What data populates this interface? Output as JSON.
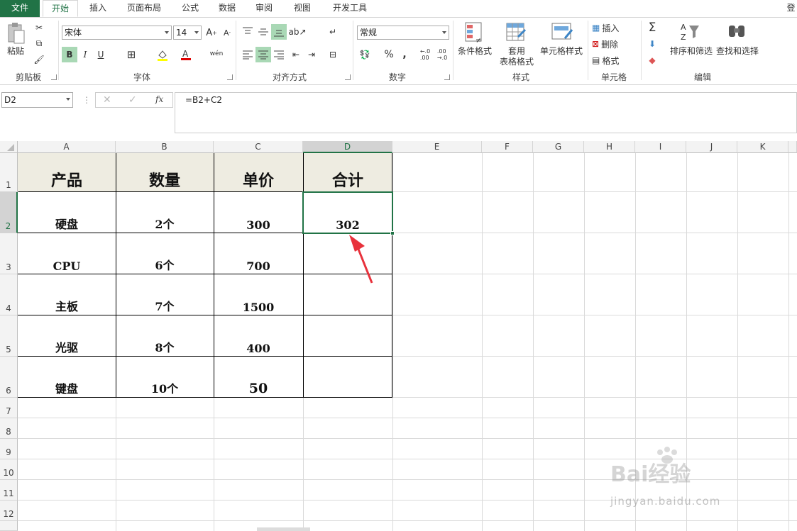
{
  "tabs": [
    "文件",
    "开始",
    "插入",
    "页面布局",
    "公式",
    "数据",
    "审阅",
    "视图",
    "开发工具"
  ],
  "login_label": "登",
  "ribbon": {
    "clipboard": {
      "paste_label": "粘贴",
      "group_label": "剪贴板"
    },
    "font": {
      "name": "宋体",
      "size": "14",
      "bold": "B",
      "italic": "I",
      "underline": "U",
      "wen": "wén",
      "group_label": "字体"
    },
    "alignment": {
      "group_label": "对齐方式"
    },
    "number": {
      "format": "常规",
      "percent": "%",
      "comma": ",",
      "group_label": "数字"
    },
    "styles": {
      "conditional": "条件格式",
      "table_format_1": "套用",
      "table_format_2": "表格格式",
      "cell_styles": "单元格样式",
      "group_label": "样式"
    },
    "cells": {
      "insert": "插入",
      "delete": "删除",
      "format": "格式",
      "group_label": "单元格"
    },
    "editing": {
      "sigma": "Σ",
      "sort_filter": "排序和筛选",
      "find_select": "查找和选择",
      "group_label": "编辑"
    }
  },
  "formula_bar": {
    "name_box": "D2",
    "fx": "fx",
    "formula": "=B2+C2"
  },
  "columns": [
    "A",
    "B",
    "C",
    "D",
    "E",
    "F",
    "G",
    "H",
    "I",
    "J",
    "K"
  ],
  "rows": [
    "1",
    "2",
    "3",
    "4",
    "5",
    "6",
    "7",
    "8",
    "9",
    "10",
    "11",
    "12"
  ],
  "table": {
    "headers": [
      "产品",
      "数量",
      "单价",
      "合计"
    ],
    "rows": [
      [
        "硬盘",
        "2个",
        "300",
        "302"
      ],
      [
        "CPU",
        "6个",
        "700",
        ""
      ],
      [
        "主板",
        "7个",
        "1500",
        ""
      ],
      [
        "光驱",
        "8个",
        "400",
        ""
      ],
      [
        "键盘",
        "10个",
        "50",
        ""
      ]
    ]
  },
  "watermark": {
    "text": "Bai经验",
    "url": "jingyan.baidu.com"
  },
  "colors": {
    "excel_green": "#217346",
    "header_fill": "#eeece1",
    "arrow": "#e8323c"
  }
}
